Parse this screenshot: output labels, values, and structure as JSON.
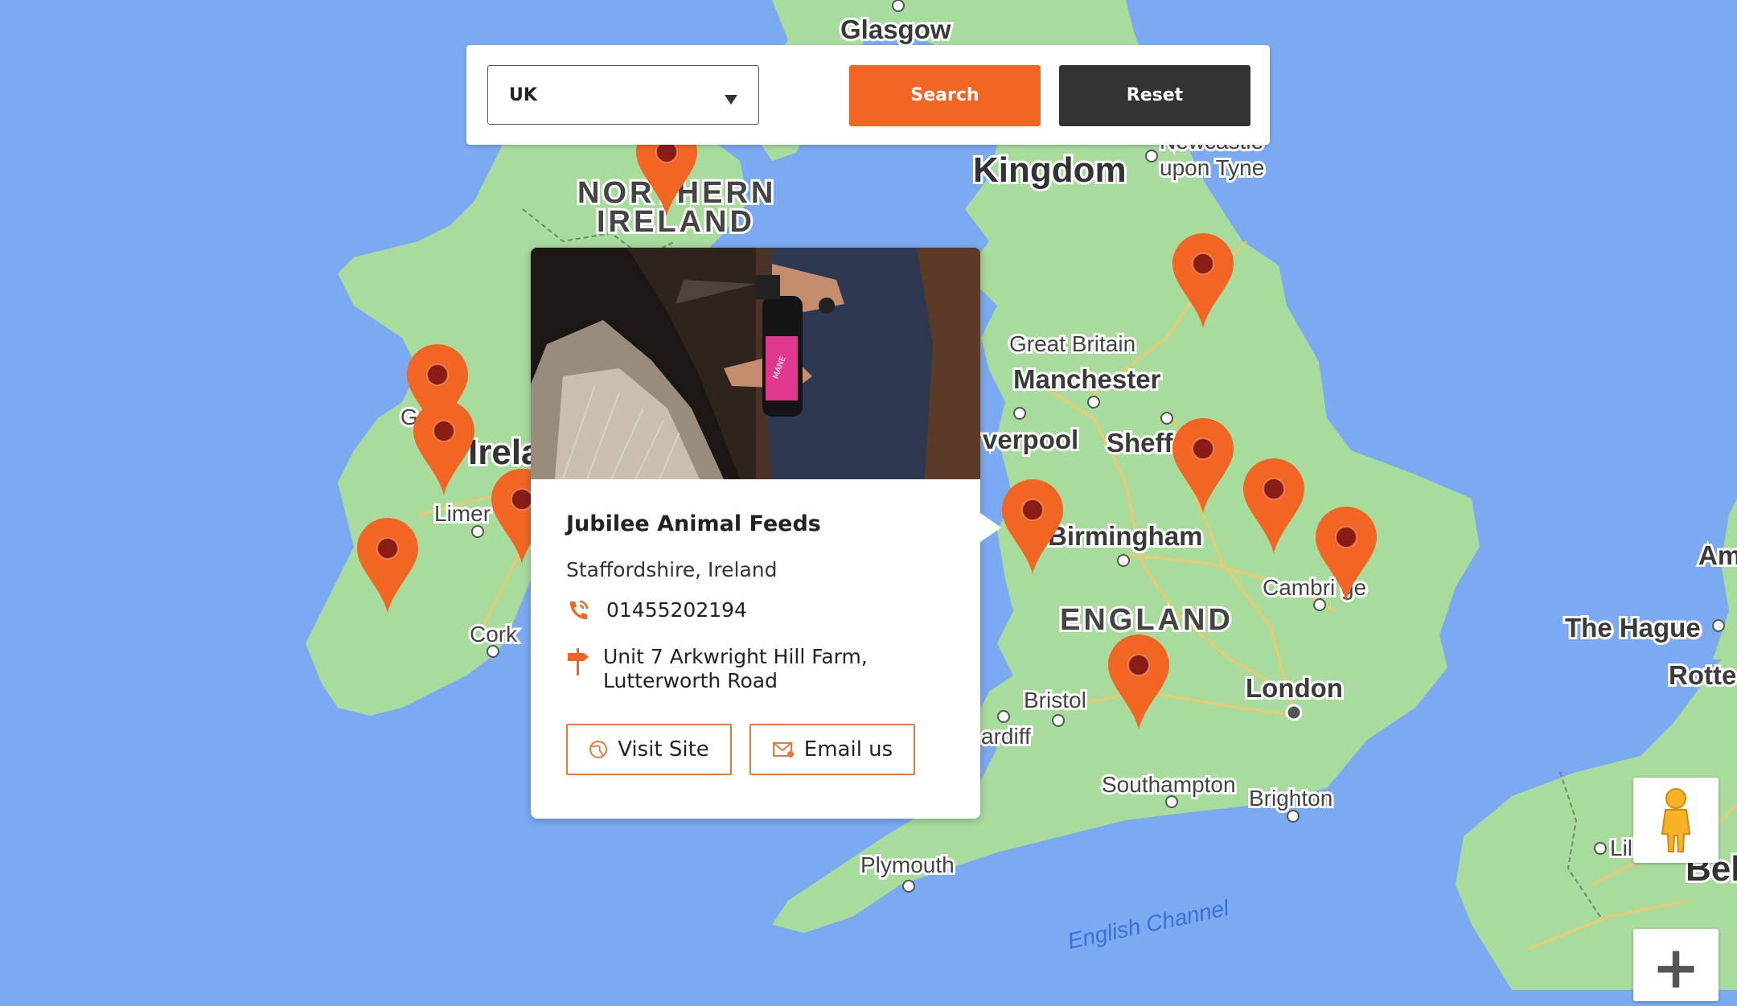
{
  "search": {
    "selected_country": "UK",
    "search_label": "Search",
    "reset_label": "Reset"
  },
  "map": {
    "labels": {
      "glasgow": "Glasgow",
      "kingdom": "Kingdom",
      "newcastle_1": "Newcastle",
      "newcastle_2": "upon Tyne",
      "northern_1": "NORTHERN",
      "northern_2": "IRELAND",
      "great_britain": "Great Britain",
      "manchester": "Manchester",
      "liverpool": "verpool",
      "sheffield": "Sheff",
      "ireland": "Irela",
      "galway": "G",
      "limerick": "Limer",
      "cork": "Cork",
      "birmingham": "Birmingham",
      "cambridge": "Cambri   ge",
      "england": "ENGLAND",
      "london": "London",
      "bristol": "Bristol",
      "cardiff": "ardiff",
      "southampton": "Southampton",
      "brighton": "Brighton",
      "plymouth": "Plymouth",
      "english_channel": "English Channel",
      "the_hague": "The Hague",
      "rotterdam": "Rotte",
      "amsterdam": "Am",
      "lille": "Lil",
      "belgium": "Bel"
    },
    "marker_color": "#f26522"
  },
  "popup": {
    "title": "Jubilee Animal Feeds",
    "location": "Staffordshire, Ireland",
    "phone": "01455202194",
    "address_line1": "Unit 7 Arkwright Hill Farm,",
    "address_line2": "Lutterworth Road",
    "visit_site_label": "Visit Site",
    "email_label": "Email us",
    "photo_label": "MANE"
  },
  "colors": {
    "accent": "#f26522",
    "dark_button": "#333333",
    "sea": "#7baaf2",
    "land": "#a8dc9d"
  }
}
